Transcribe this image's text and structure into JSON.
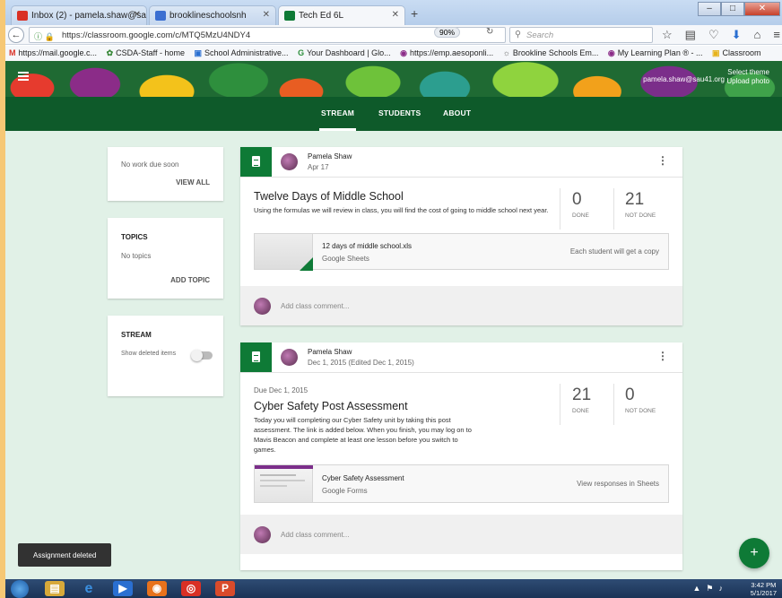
{
  "browser": {
    "tabs": [
      {
        "label": "Inbox (2) - pamela.shaw@sa",
        "active": false,
        "favicon_color": "#d93025"
      },
      {
        "label": "brooklineschoolsnh",
        "active": false,
        "favicon_color": "#3b6fd1"
      },
      {
        "label": "Tech Ed 6L",
        "active": true,
        "favicon_color": "#0e7a36"
      }
    ],
    "url": "https://classroom.google.com/c/MTQ5MzU4NDY4",
    "zoom": "90%",
    "search_placeholder": "Search",
    "bookmarks": [
      {
        "icon": "M",
        "label": "https://mail.google.c..."
      },
      {
        "icon": "✿",
        "label": "CSDA-Staff - home"
      },
      {
        "icon": "▣",
        "label": "School Administrative..."
      },
      {
        "icon": "G",
        "label": "Your Dashboard | Glo..."
      },
      {
        "icon": "◉",
        "label": "https://emp.aesoponli..."
      },
      {
        "icon": "☼",
        "label": "Brookline Schools Em..."
      },
      {
        "icon": "◉",
        "label": "My Learning Plan ® - ..."
      },
      {
        "icon": "▣",
        "label": "Classroom"
      }
    ]
  },
  "header": {
    "select_theme": "Select theme",
    "upload_photo": "Upload photo",
    "user_email": "pamela.shaw@sau41.org"
  },
  "nav": {
    "tabs": [
      "STREAM",
      "STUDENTS",
      "ABOUT"
    ],
    "active": "STREAM"
  },
  "sidebar": {
    "upcoming_text": "No work due soon",
    "view_all": "VIEW ALL",
    "topics_header": "TOPICS",
    "topics_empty": "No topics",
    "add_topic": "ADD TOPIC",
    "stream_header": "STREAM",
    "show_deleted": "Show deleted items"
  },
  "posts": [
    {
      "author": "Pamela Shaw",
      "date": "Apr 17",
      "due": "",
      "title": "Twelve Days of Middle School",
      "description": "Using the formulas we will review in class, you will find the cost of going to middle school next year.",
      "done": "0",
      "done_label": "DONE",
      "not_done": "21",
      "not_done_label": "NOT DONE",
      "attachment_title": "12 days of middle school.xls",
      "attachment_type": "Google Sheets",
      "attachment_note": "Each student will get a copy",
      "comment_placeholder": "Add class comment..."
    },
    {
      "author": "Pamela Shaw",
      "date": "Dec 1, 2015 (Edited Dec 1, 2015)",
      "due": "Due Dec 1, 2015",
      "title": "Cyber Safety Post Assessment",
      "description": "Today you will completing our Cyber Safety unit by taking this post assessment. The link is added below. When you finish, you may log on to Mavis Beacon and complete at least one lesson before you switch to games.",
      "done": "21",
      "done_label": "DONE",
      "not_done": "0",
      "not_done_label": "NOT DONE",
      "attachment_title": "Cyber Safety Assessment",
      "attachment_type": "Google Forms",
      "attachment_note": "View responses in Sheets",
      "comment_placeholder": "Add class comment..."
    }
  ],
  "snackbar": "Assignment deleted",
  "fab_label": "+",
  "taskbar": {
    "time": "3:42 PM",
    "date": "5/1/2017"
  }
}
